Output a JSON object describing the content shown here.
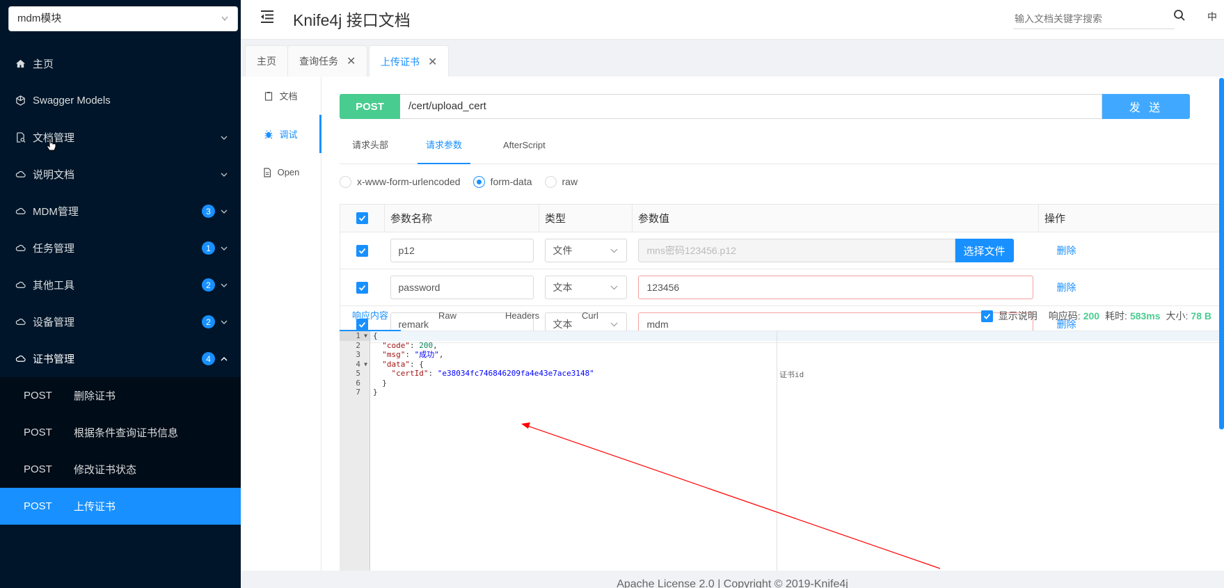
{
  "sidebar": {
    "module_select": "mdm模块",
    "items": [
      {
        "label": "主页",
        "icon": "home-icon"
      },
      {
        "label": "Swagger Models",
        "icon": "cube-icon"
      },
      {
        "label": "文档管理",
        "icon": "file-search-icon"
      },
      {
        "label": "说明文档",
        "icon": "cloud-icon"
      },
      {
        "label": "MDM管理",
        "icon": "cloud-icon",
        "badge": "3"
      },
      {
        "label": "任务管理",
        "icon": "cloud-icon",
        "badge": "1"
      },
      {
        "label": "其他工具",
        "icon": "cloud-icon",
        "badge": "2"
      },
      {
        "label": "设备管理",
        "icon": "cloud-icon",
        "badge": "2"
      },
      {
        "label": "证书管理",
        "icon": "cloud-icon",
        "badge": "4"
      }
    ],
    "sub_items": [
      {
        "method": "POST",
        "label": "删除证书"
      },
      {
        "method": "POST",
        "label": "根据条件查询证书信息"
      },
      {
        "method": "POST",
        "label": "修改证书状态"
      },
      {
        "method": "POST",
        "label": "上传证书"
      }
    ]
  },
  "header": {
    "title": "Knife4j 接口文档",
    "search_placeholder": "输入文档关键字搜索",
    "lang": "中"
  },
  "tabs": [
    {
      "label": "主页"
    },
    {
      "label": "查询任务"
    },
    {
      "label": "上传证书"
    }
  ],
  "side_nav": [
    {
      "label": "文档"
    },
    {
      "label": "调试"
    },
    {
      "label": "Open"
    }
  ],
  "request": {
    "method": "POST",
    "url": "/cert/upload_cert",
    "send_label": "发 送",
    "tabs": [
      "请求头部",
      "请求参数",
      "AfterScript"
    ],
    "content_types": [
      "x-www-form-urlencoded",
      "form-data",
      "raw"
    ],
    "columns": [
      "参数名称",
      "类型",
      "参数值",
      "操作"
    ],
    "params": [
      {
        "name": "p12",
        "type": "文件",
        "value": "mns密码123456.p12",
        "file_button": "选择文件",
        "action": "删除"
      },
      {
        "name": "password",
        "type": "文本",
        "value": "123456",
        "action": "删除"
      },
      {
        "name": "remark",
        "type": "文本",
        "value": "mdm",
        "action": "删除"
      }
    ]
  },
  "response": {
    "tabs": [
      "响应内容",
      "Raw",
      "Headers",
      "Curl"
    ],
    "show_desc_label": "显示说明",
    "status_label": "响应码:",
    "status_value": "200",
    "time_label": "耗时:",
    "time_value": "583ms",
    "size_label": "大小:",
    "size_value": "78 B",
    "line_numbers": [
      "1",
      "2",
      "3",
      "4",
      "5",
      "6",
      "7"
    ],
    "code": {
      "open": "{",
      "code_key": "\"code\"",
      "code_val": "200",
      "msg_key": "\"msg\"",
      "msg_val": "\"成功\"",
      "data_key": "\"data\"",
      "certid_key": "\"certId\"",
      "certid_val": "\"e38034fc746846209fa4e43e7ace3148\"",
      "inner_close": "}",
      "close": "}"
    },
    "desc": "证书id"
  },
  "footer": "Apache License 2.0 | Copyright © 2019-Knife4j",
  "colors": {
    "sidebar_bg": "#001529",
    "accent": "#1890ff",
    "post_green": "#49cc90",
    "annotation_arrow": "#ff0000"
  }
}
